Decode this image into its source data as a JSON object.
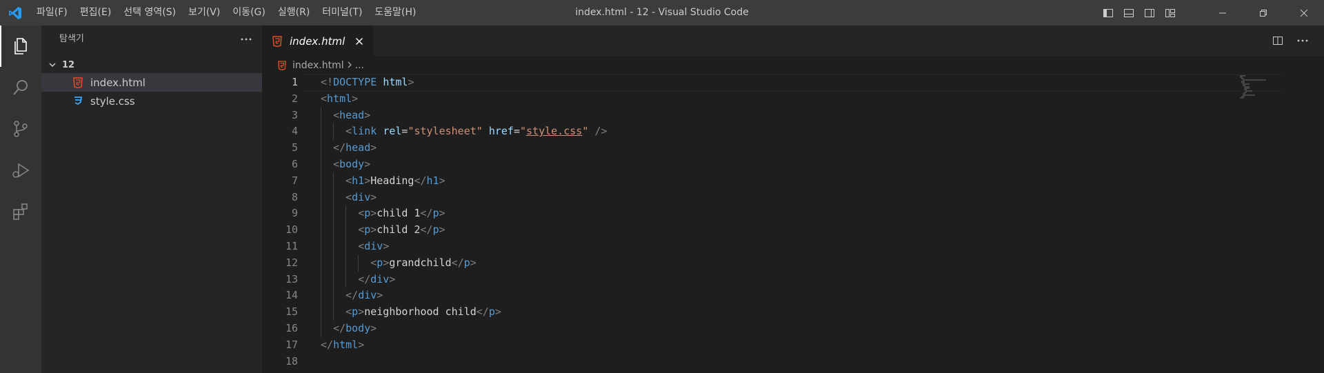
{
  "window": {
    "title": "index.html - 12 - Visual Studio Code"
  },
  "menu": {
    "items": [
      "파일(F)",
      "편집(E)",
      "선택 영역(S)",
      "보기(V)",
      "이동(G)",
      "실행(R)",
      "터미널(T)",
      "도움말(H)"
    ]
  },
  "sidebar": {
    "title": "탐색기",
    "folder": "12",
    "files": [
      {
        "name": "index.html",
        "icon": "html5-icon",
        "selected": true
      },
      {
        "name": "style.css",
        "icon": "css3-icon",
        "selected": false
      }
    ]
  },
  "editor": {
    "tab_label": "index.html",
    "breadcrumb": {
      "file": "index.html",
      "rest": "..."
    },
    "current_line": 1,
    "lines": [
      {
        "num": "1",
        "text": "<!DOCTYPE html>"
      },
      {
        "num": "2",
        "text": "<html>"
      },
      {
        "num": "3",
        "text": "  <head>"
      },
      {
        "num": "4",
        "text": "    <link rel=\"stylesheet\" href=\"style.css\" />"
      },
      {
        "num": "5",
        "text": "  </head>"
      },
      {
        "num": "6",
        "text": "  <body>"
      },
      {
        "num": "7",
        "text": "    <h1>Heading</h1>"
      },
      {
        "num": "8",
        "text": "    <div>"
      },
      {
        "num": "9",
        "text": "      <p>child 1</p>"
      },
      {
        "num": "10",
        "text": "      <p>child 2</p>"
      },
      {
        "num": "11",
        "text": "      <div>"
      },
      {
        "num": "12",
        "text": "        <p>grandchild</p>"
      },
      {
        "num": "13",
        "text": "      </div>"
      },
      {
        "num": "14",
        "text": "    </div>"
      },
      {
        "num": "15",
        "text": "    <p>neighborhood child</p>"
      },
      {
        "num": "16",
        "text": "  </body>"
      },
      {
        "num": "17",
        "text": "</html>"
      },
      {
        "num": "18",
        "text": ""
      }
    ]
  },
  "colors": {
    "titlebar": "#3c3c3c",
    "activitybar": "#333333",
    "sidebar": "#252526",
    "editor": "#1e1e1e",
    "accent": "#0078d4",
    "html_icon": "#e44d26",
    "css_icon": "#42a5f5"
  }
}
